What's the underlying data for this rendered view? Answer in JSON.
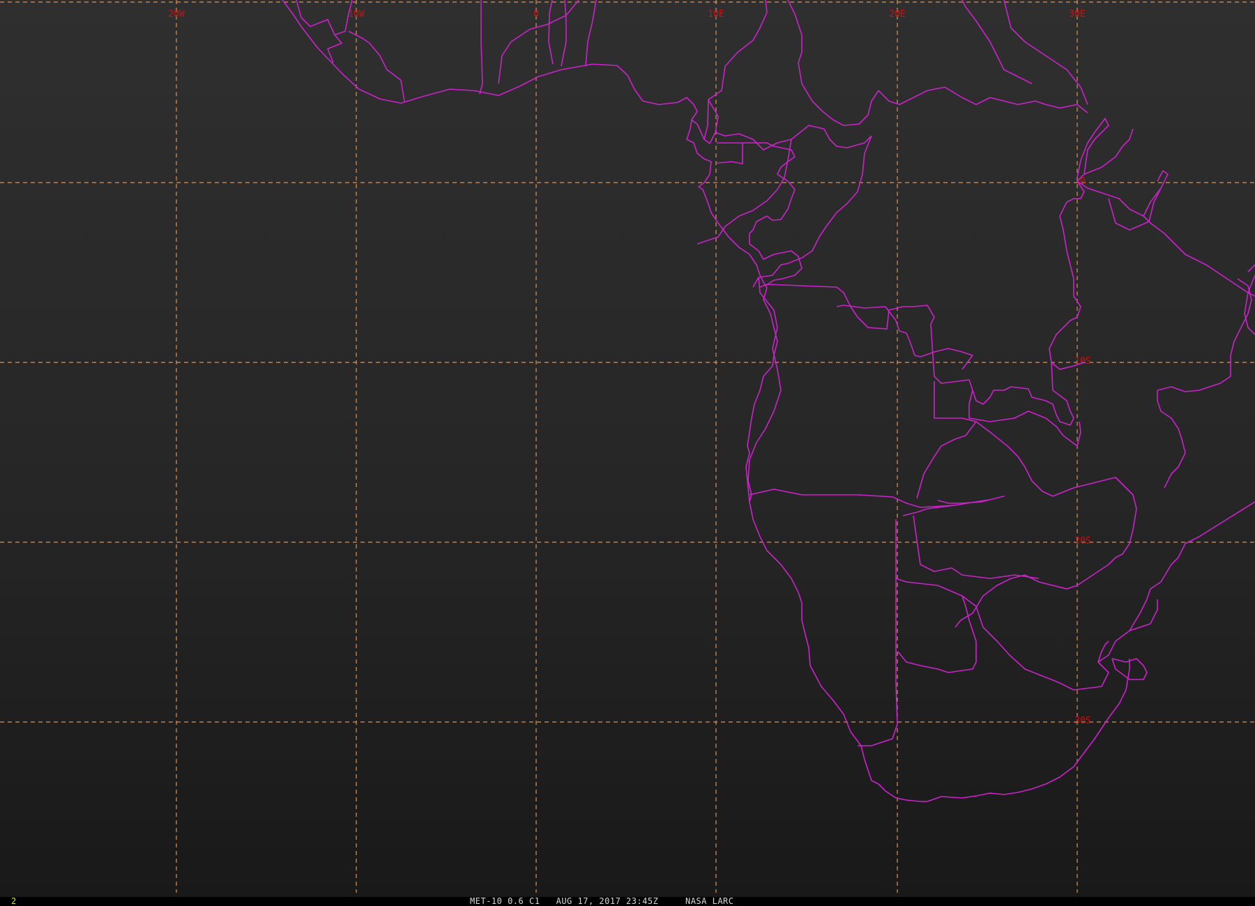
{
  "map": {
    "background_color": "#262626",
    "grid_color": "#d9945a",
    "border_color": "#cc22cc",
    "label_color": "#cc1111",
    "longitude_labels": [
      "20W",
      "10W",
      "0",
      "10E",
      "20E",
      "30E"
    ],
    "latitude_labels": [
      "0",
      "10S",
      "20S",
      "30S"
    ]
  },
  "status_bar": {
    "frame_number": "2",
    "caption": "MET-10 0.6 C1   AUG 17, 2017 23:45Z     NASA LARC"
  }
}
